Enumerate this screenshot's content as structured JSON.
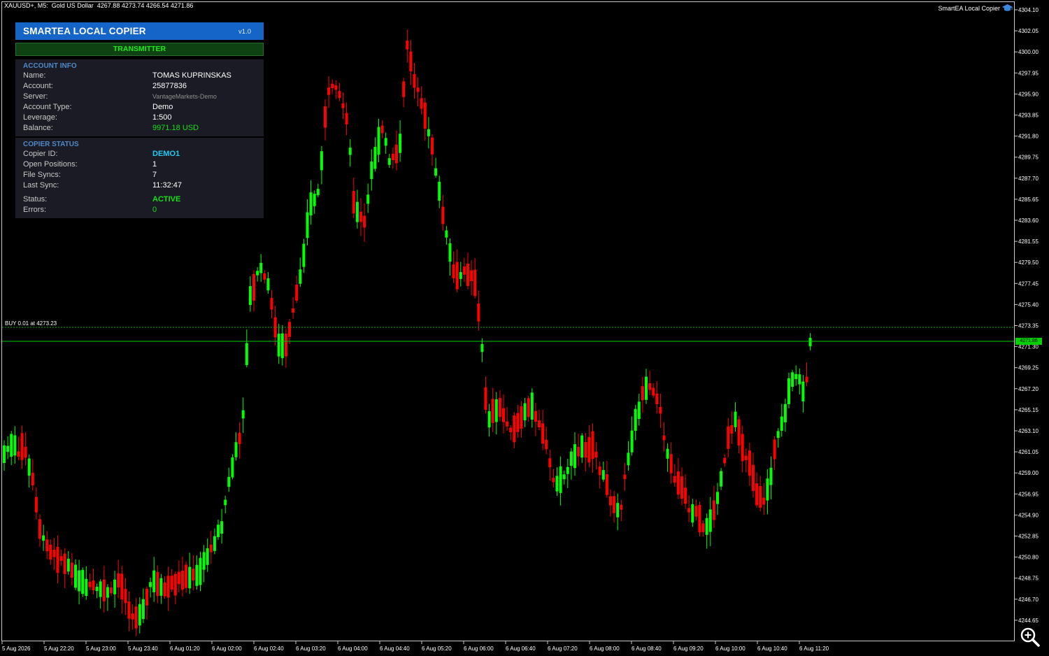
{
  "chart": {
    "symbol_info": "XAUUSD+, M5:  Gold US Dollar  4267.88 4273.74 4266.54 4271.86",
    "ea_name": "SmartEA Local Copier",
    "buy_line_label": "BUY 0.01 at 4273.23",
    "current_price_tag": "4271.86",
    "price_levels": [
      "4304.10",
      "4302.05",
      "4300.00",
      "4297.95",
      "4295.90",
      "4293.85",
      "4291.80",
      "4289.75",
      "4287.70",
      "4285.65",
      "4283.60",
      "4281.55",
      "4279.50",
      "4277.45",
      "4275.40",
      "4273.35",
      "4271.30",
      "4269.25",
      "4267.20",
      "4265.15",
      "4263.10",
      "4261.05",
      "4259.00",
      "4256.95",
      "4254.90",
      "4252.85",
      "4250.80",
      "4248.75",
      "4246.70",
      "4244.65"
    ],
    "time_labels": [
      "5 Aug 2026",
      "5 Aug 22:20",
      "5 Aug 23:00",
      "5 Aug 23:40",
      "6 Aug 01:20",
      "6 Aug 02:00",
      "6 Aug 02:40",
      "6 Aug 03:20",
      "6 Aug 04:00",
      "6 Aug 04:40",
      "6 Aug 05:20",
      "6 Aug 06:00",
      "6 Aug 06:40",
      "6 Aug 07:20",
      "6 Aug 08:00",
      "6 Aug 08:40",
      "6 Aug 09:20",
      "6 Aug 10:00",
      "6 Aug 10:40",
      "6 Aug 11:20"
    ],
    "bull_color": "#00ff00",
    "bear_color": "#ff0000",
    "price_line_color": "#00d000",
    "zoom_icon": "magnifier-zoom-icon",
    "ea_icon": "graduation-cap-icon"
  },
  "panel": {
    "title": "SMARTEA LOCAL COPIER",
    "version": "v1.0",
    "mode": "TRANSMITTER",
    "account_info": {
      "heading": "ACCOUNT INFO",
      "name_label": "Name:",
      "name": "TOMAS KUPRINSKAS",
      "account_label": "Account:",
      "account": "25877836",
      "server_label": "Server:",
      "server": "VantageMarkets-Demo",
      "type_label": "Account Type:",
      "type": "Demo",
      "leverage_label": "Leverage:",
      "leverage": "1:500",
      "balance_label": "Balance:",
      "balance": "9971.18 USD"
    },
    "copier_status": {
      "heading": "COPIER STATUS",
      "id_label": "Copier ID:",
      "id": "DEMO1",
      "positions_label": "Open Positions:",
      "positions": "1",
      "syncs_label": "File Syncs:",
      "syncs": "7",
      "last_sync_label": "Last Sync:",
      "last_sync": "11:32:47",
      "status_label": "Status:",
      "status": "ACTIVE",
      "errors_label": "Errors:",
      "errors": "0"
    }
  }
}
